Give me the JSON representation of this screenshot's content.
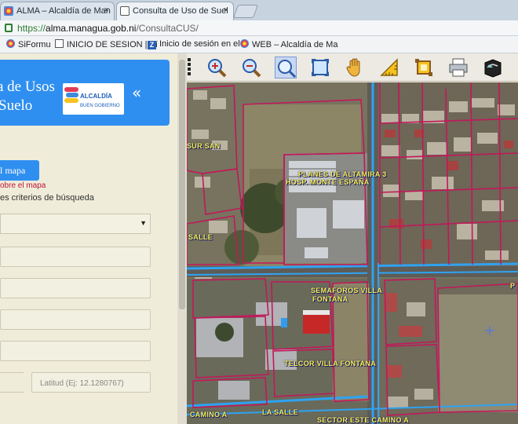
{
  "browser": {
    "tabs": [
      {
        "title": "ALMA – Alcaldía de Man",
        "close": "×",
        "favicon_color": "#e23c55"
      },
      {
        "title": "Consulta de Uso de Suel",
        "close": "×",
        "favicon_color": "#ffffff"
      }
    ],
    "address": {
      "scheme": "https://",
      "host": "alma.managua.gob.ni",
      "path": "/ConsultaCUS/"
    },
    "bookmarks": [
      {
        "label": "SiFormu",
        "icon": "flower-icon"
      },
      {
        "label": "INICIO DE SESION | Sí",
        "icon": "document-icon"
      },
      {
        "label": "Inicio de sesión en el",
        "icon": "z-icon"
      },
      {
        "label": "WEB – Alcaldía de Ma",
        "icon": "flower-icon"
      }
    ]
  },
  "panel": {
    "title_line1": "a de Usos",
    "title_line2": "Suelo",
    "logo": {
      "name": "ALCALDÍA",
      "tagline": "BUEN GOBIERNO"
    },
    "collapse": "«",
    "map_button": "l mapa",
    "map_link": "obre el mapa",
    "criteria": "es criterios de búsqueda",
    "select_caret": "▼",
    "latitude_placeholder": "Latitud (Ej: 12.1280767)"
  },
  "toolbar": {
    "tools": [
      "zoom-in-icon",
      "zoom-out-icon",
      "zoom-box-icon",
      "full-extent-icon",
      "pan-hand-icon",
      "measure-icon",
      "select-area-icon",
      "print-icon",
      "identify-icon"
    ]
  },
  "map": {
    "labels": {
      "sur_san": "SUR SAN",
      "planes_altamira": "PLANES DE ALTAMIRA 3",
      "hosp_monte_espana": "HOSP. MONTE ESPAÑA",
      "salle": "SALLE",
      "semaforos": "SEMAFOROS VILLA",
      "fontana": "FONTANA",
      "telcor": "TELCOR VILLA FONTANA",
      "camino_a": "CAMINO A",
      "la_salle": "LA SALLE",
      "sector_este": "SECTOR ESTE CAMINO A",
      "edge_p": "P"
    },
    "colors": {
      "parcel": "#c2185b",
      "road": "#2ea3f2",
      "label": "#f6f04a"
    }
  }
}
